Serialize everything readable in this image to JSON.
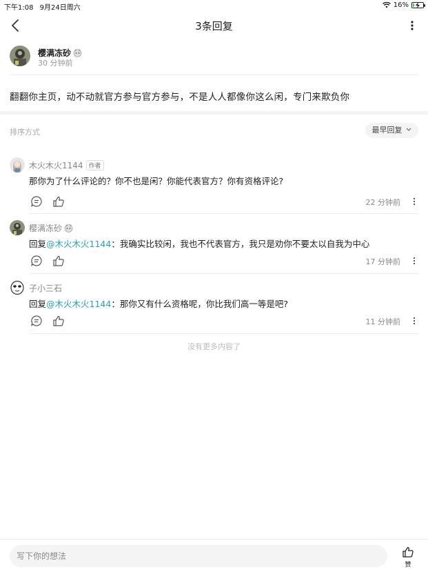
{
  "status_bar": {
    "time": "下午1:08",
    "date": "9月24日周六",
    "battery_pct": "16%",
    "battery_level": 0.16
  },
  "nav": {
    "title": "3条回复"
  },
  "post": {
    "author": "樱满冻砂",
    "time": "30 分钟前",
    "text": "翻翻你主页，动不动就官方参与官方参与，不是人人都像你这么闲，专门来欺负你"
  },
  "sort": {
    "label": "排序方式",
    "selected": "最早回复"
  },
  "comments": [
    {
      "name": "木火木火1144",
      "tag": "作者",
      "text": "那你为了什么评论的？你不也是闲？你能代表官方？你有资格评论?",
      "time": "22 分钟前"
    },
    {
      "name": "樱满冻砂",
      "reply_prefix": "回复",
      "mention": "@木火木火1144",
      "text": "：我确实比较闲，我也不代表官方，我只是劝你不要太以自我为中心",
      "time": "17 分钟前"
    },
    {
      "name": "子小三石",
      "reply_prefix": "回复",
      "mention": "@木火木火1144",
      "text": "：那你又有什么资格呢，你比我们高一等是吧?",
      "time": "11 分钟前"
    }
  ],
  "no_more": "没有更多内容了",
  "bottom": {
    "input_placeholder": "写下你的想法",
    "like_label": "赞"
  },
  "colors": {
    "mention": "#26a4bb",
    "battery": "#34c759"
  }
}
